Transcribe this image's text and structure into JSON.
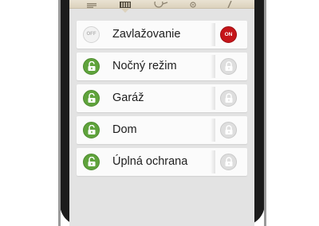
{
  "tabs": [
    {
      "icon": "menu-icon"
    },
    {
      "icon": "building-icon",
      "active": true
    },
    {
      "icon": "key-icon"
    },
    {
      "icon": "location-pin-icon"
    },
    {
      "icon": "pen-icon"
    }
  ],
  "rows": [
    {
      "label": "Zavlažovanie",
      "lead_icon": "off-toggle",
      "lead_text": "OFF",
      "trail_icon": "on-toggle",
      "trail_text": "ON"
    },
    {
      "label": "Nočný režim",
      "lead_icon": "unlocked-padlock-icon",
      "trail_icon": "locked-padlock-icon"
    },
    {
      "label": "Garáž",
      "lead_icon": "unlocked-padlock-icon",
      "trail_icon": "locked-padlock-icon"
    },
    {
      "label": "Dom",
      "lead_icon": "unlocked-padlock-icon",
      "trail_icon": "locked-padlock-icon"
    },
    {
      "label": "Úplná ochrana",
      "lead_icon": "unlocked-padlock-icon",
      "trail_icon": "locked-padlock-icon"
    }
  ],
  "colors": {
    "on_red": "#c5151a",
    "unlock_green": "#5fa33c",
    "lock_grey": "#dedede",
    "tabbar_beige": "#dcd2bd"
  }
}
